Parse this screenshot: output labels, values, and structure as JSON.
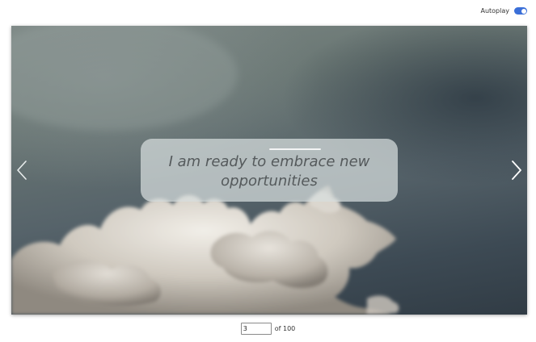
{
  "autoplay": {
    "label": "Autoplay",
    "enabled": true,
    "color": "#3b6fd8"
  },
  "slide": {
    "quote": "I am ready to embrace new opportunities",
    "prev_icon": "chevron-left-icon",
    "next_icon": "chevron-right-icon"
  },
  "pager": {
    "current_page": "3",
    "total_label": "of 100"
  }
}
